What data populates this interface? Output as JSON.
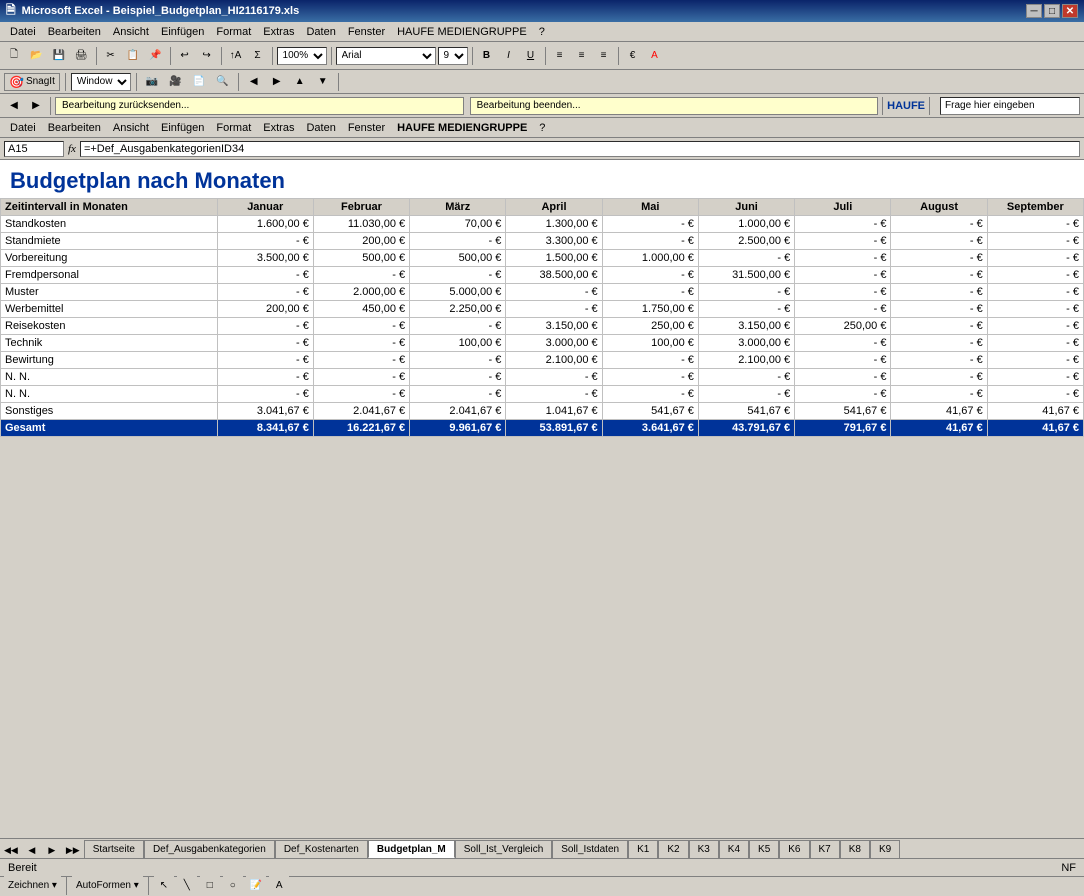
{
  "titleBar": {
    "icon": "excel-icon",
    "title": "Microsoft Excel - Beispiel_Budgetplan_HI2116179.xls",
    "minimize": "─",
    "restore": "□",
    "close": "✕"
  },
  "menuBar": {
    "items": [
      "Datei",
      "Bearbeiten",
      "Ansicht",
      "Einfügen",
      "Format",
      "Extras",
      "Daten",
      "Fenster",
      "HAUFE MEDIENGRUPPE",
      "?"
    ]
  },
  "toolbar1": {
    "zoom": "100%",
    "fontName": "Arial",
    "fontSize": "9"
  },
  "toolbar2": {
    "snagit": "SnagIt",
    "window": "Window"
  },
  "toolbar3": {
    "editingLabel": "Bearbeitung zurücksenden...",
    "endLabel": "Bearbeitung beenden..."
  },
  "formulaBar": {
    "cellRef": "A15",
    "formula": "=+Def_AusgabenkategorienID34"
  },
  "sheet": {
    "title": "Budgetplan nach Monaten",
    "headers": [
      "Zeitintervall in Monaten",
      "Januar",
      "Februar",
      "März",
      "April",
      "Mai",
      "Juni",
      "Juli",
      "August",
      "September"
    ],
    "rows": [
      {
        "label": "Standkosten",
        "values": [
          "1.600,00 €",
          "11.030,00 €",
          "70,00 €",
          "1.300,00 €",
          "- €",
          "1.000,00 €",
          "- €",
          "- €",
          "- €"
        ]
      },
      {
        "label": "Standmiete",
        "values": [
          "- €",
          "200,00 €",
          "- €",
          "3.300,00 €",
          "- €",
          "2.500,00 €",
          "- €",
          "- €",
          "- €"
        ]
      },
      {
        "label": "Vorbereitung",
        "values": [
          "3.500,00 €",
          "500,00 €",
          "500,00 €",
          "1.500,00 €",
          "1.000,00 €",
          "- €",
          "- €",
          "- €",
          "- €"
        ]
      },
      {
        "label": "Fremdpersonal",
        "values": [
          "- €",
          "- €",
          "- €",
          "38.500,00 €",
          "- €",
          "31.500,00 €",
          "- €",
          "- €",
          "- €"
        ]
      },
      {
        "label": "Muster",
        "values": [
          "- €",
          "2.000,00 €",
          "5.000,00 €",
          "- €",
          "- €",
          "- €",
          "- €",
          "- €",
          "- €"
        ]
      },
      {
        "label": "Werbemittel",
        "values": [
          "200,00 €",
          "450,00 €",
          "2.250,00 €",
          "- €",
          "1.750,00 €",
          "- €",
          "- €",
          "- €",
          "- €"
        ]
      },
      {
        "label": "Reisekosten",
        "values": [
          "- €",
          "- €",
          "- €",
          "3.150,00 €",
          "250,00 €",
          "3.150,00 €",
          "250,00 €",
          "- €",
          "- €"
        ]
      },
      {
        "label": "Technik",
        "values": [
          "- €",
          "- €",
          "100,00 €",
          "3.000,00 €",
          "100,00 €",
          "3.000,00 €",
          "- €",
          "- €",
          "- €"
        ]
      },
      {
        "label": "Bewirtung",
        "values": [
          "- €",
          "- €",
          "- €",
          "2.100,00 €",
          "- €",
          "2.100,00 €",
          "- €",
          "- €",
          "- €"
        ]
      },
      {
        "label": "N. N.",
        "values": [
          "- €",
          "- €",
          "- €",
          "- €",
          "- €",
          "- €",
          "- €",
          "- €",
          "- €"
        ]
      },
      {
        "label": "N. N.",
        "values": [
          "- €",
          "- €",
          "- €",
          "- €",
          "- €",
          "- €",
          "- €",
          "- €",
          "- €"
        ]
      },
      {
        "label": "Sonstiges",
        "values": [
          "3.041,67 €",
          "2.041,67 €",
          "2.041,67 €",
          "1.041,67 €",
          "541,67 €",
          "541,67 €",
          "541,67 €",
          "41,67 €",
          "41,67 €"
        ]
      },
      {
        "label": "Gesamt",
        "values": [
          "8.341,67 €",
          "16.221,67 €",
          "9.961,67 €",
          "53.891,67 €",
          "3.641,67 €",
          "43.791,67 €",
          "791,67 €",
          "41,67 €",
          "41,67 €"
        ],
        "isTotal": true
      }
    ]
  },
  "sheetTabs": {
    "tabs": [
      "Startseite",
      "Def_Ausgabenkategorien",
      "Def_Kostenarten",
      "Budgetplan_M",
      "Soll_Ist_Vergleich",
      "Soll_Istdaten",
      "K1",
      "K2",
      "K3",
      "K4",
      "K5",
      "K6",
      "K7",
      "K8",
      "K9"
    ],
    "active": "Budgetplan_M"
  },
  "statusBar": {
    "ready": "Bereit",
    "nf": "NF"
  },
  "bottomToolbar": {
    "zeichnen": "Zeichnen ▾",
    "autoformen": "AutoFormen ▾"
  }
}
